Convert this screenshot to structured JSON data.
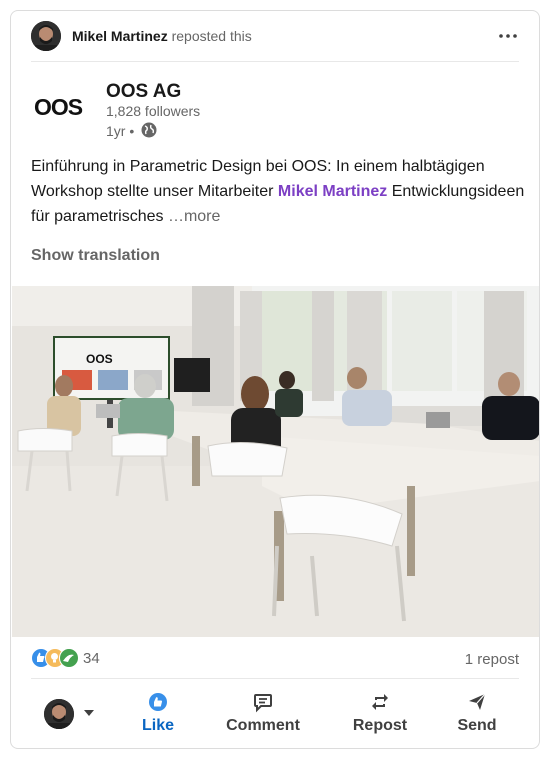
{
  "repost": {
    "name": "Mikel Martinez",
    "action": "reposted this",
    "menu_icon": "more-horizontal-icon"
  },
  "actor": {
    "logo_text": "OOS",
    "company": "OOS AG",
    "followers": "1,828 followers",
    "time": "1yr •",
    "visibility_icon": "globe-icon"
  },
  "post": {
    "text_before": "Einführung in Parametric Design bei OOS: In einem halbtägigen Workshop stellte unser Mitarbeiter ",
    "mention": "Mikel Martinez",
    "text_after": " Entwicklungsideen für parametrisches ",
    "more": "…more",
    "show_translation": "Show translation"
  },
  "photo": {
    "screen_logo": "OOS"
  },
  "social": {
    "reactions": [
      "like-reaction-icon",
      "idea-reaction-icon",
      "support-reaction-icon"
    ],
    "reaction_count": "34",
    "repost_count": "1 repost"
  },
  "actions": {
    "like": "Like",
    "comment": "Comment",
    "repost": "Repost",
    "send": "Send"
  },
  "colors": {
    "accent": "#0a66c2",
    "mention": "#7c3fc4",
    "muted": "#666666"
  }
}
